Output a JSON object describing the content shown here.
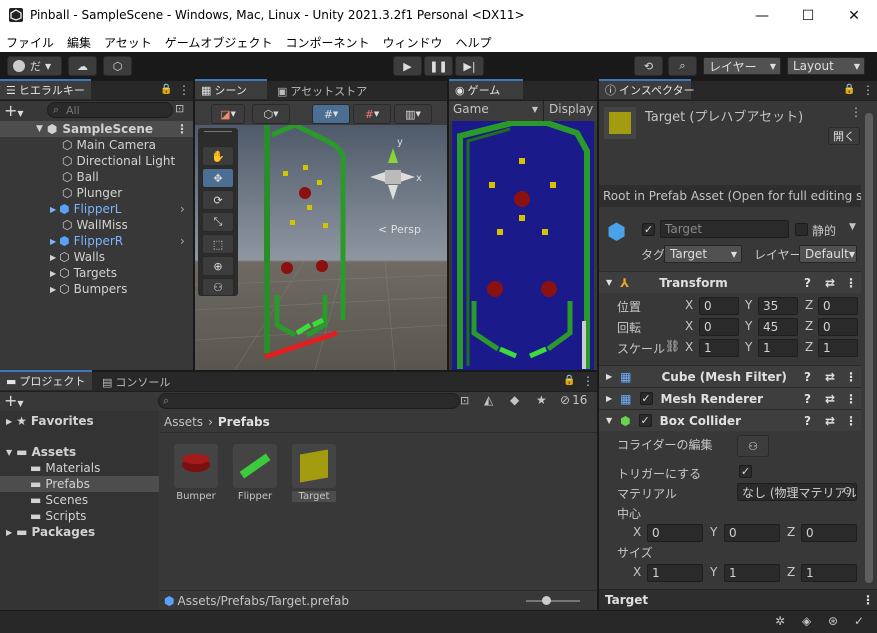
{
  "window": {
    "title": "Pinball - SampleScene - Windows, Mac, Linux - Unity 2021.3.2f1 Personal <DX11>"
  },
  "menu": [
    "ファイル",
    "編集",
    "アセット",
    "ゲームオブジェクト",
    "コンポーネント",
    "ウィンドウ",
    "ヘルプ"
  ],
  "toolbar": {
    "account": "だ",
    "layers": "レイヤー",
    "layout": "Layout"
  },
  "hierarchy": {
    "tab": "ヒエラルキー",
    "search_placeholder": "All",
    "scene": "SampleScene",
    "items": [
      "Main Camera",
      "Directional Light",
      "Ball",
      "Plunger",
      "FlipperL",
      "WallMiss",
      "FlipperR",
      "Walls",
      "Targets",
      "Bumpers"
    ]
  },
  "scene_view": {
    "tab_scene": "シーン",
    "tab_store": "アセットストア",
    "gizmo_y": "y",
    "gizmo_x": "x",
    "persp": "Persp"
  },
  "game_view": {
    "tab": "ゲーム",
    "display_mode": "Game",
    "display": "Display"
  },
  "project": {
    "tab_project": "プロジェクト",
    "tab_console": "コンソール",
    "hidden_count": "16",
    "favorites": "Favorites",
    "assets": "Assets",
    "folders": [
      "Materials",
      "Prefabs",
      "Scenes",
      "Scripts"
    ],
    "packages": "Packages",
    "breadcrumb_root": "Assets",
    "breadcrumb_current": "Prefabs",
    "items": [
      "Bumper",
      "Flipper",
      "Target"
    ],
    "path": "Assets/Prefabs/Target.prefab"
  },
  "inspector": {
    "tab": "インスペクター",
    "header": "Target (プレハブアセット)",
    "open_button": "開く",
    "note": "Root in Prefab Asset (Open for full editing su",
    "name": "Target",
    "static": "静的",
    "tag_label": "タグ",
    "tag": "Target",
    "layer_label": "レイヤー",
    "layer": "Default",
    "transform": {
      "title": "Transform",
      "position_label": "位置",
      "position": {
        "x": "0",
        "y": "35",
        "z": "0"
      },
      "rotation_label": "回転",
      "rotation": {
        "x": "0",
        "y": "45",
        "z": "0"
      },
      "scale_label": "スケール",
      "scale": {
        "x": "1",
        "y": "1",
        "z": "1"
      }
    },
    "components": [
      "Cube (Mesh Filter)",
      "Mesh Renderer",
      "Box Collider"
    ],
    "box_collider": {
      "edit_label": "コライダーの編集",
      "trigger_label": "トリガーにする",
      "material_label": "マテリアル",
      "material": "なし (物理マテリアル",
      "center_label": "中心",
      "center": {
        "x": "0",
        "y": "0",
        "z": "0"
      },
      "size_label": "サイズ",
      "size": {
        "x": "1",
        "y": "1",
        "z": "1"
      }
    },
    "footer": "Target"
  },
  "axis_labels": {
    "x": "X",
    "y": "Y",
    "z": "Z"
  }
}
